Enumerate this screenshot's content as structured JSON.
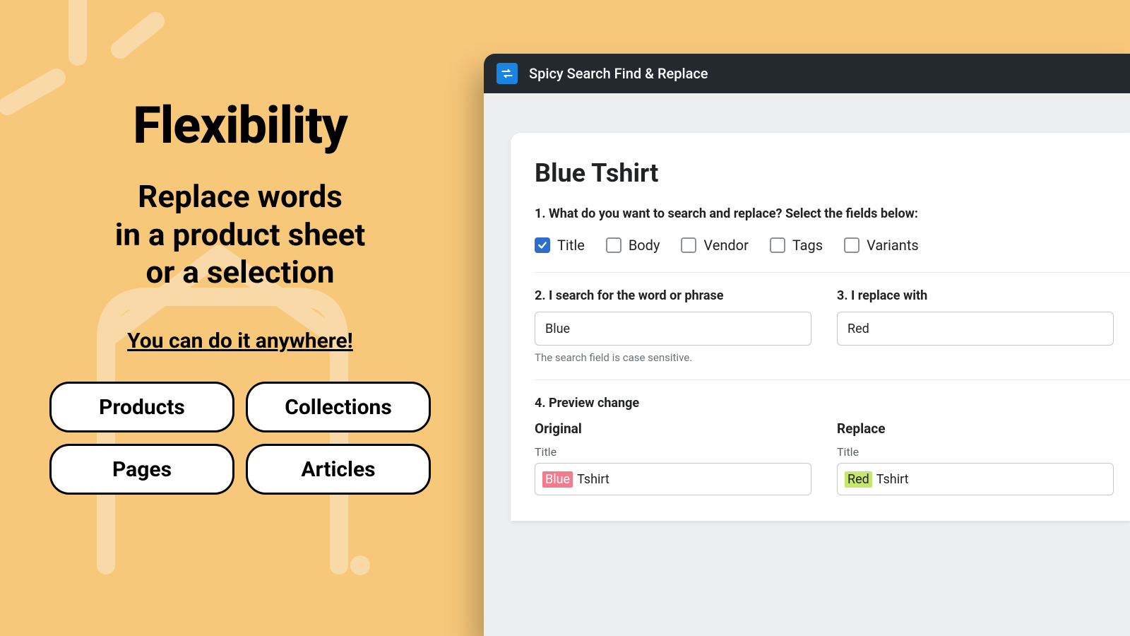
{
  "marketing": {
    "headline": "Flexibility",
    "subhead_line1": "Replace words",
    "subhead_line2": "in a product sheet",
    "subhead_line3": "or a selection",
    "tagline": "You can do it anywhere!",
    "pills": [
      "Products",
      "Collections",
      "Pages",
      "Articles"
    ]
  },
  "app": {
    "title": "Spicy Search Find & Replace",
    "card": {
      "page_title": "Blue Tshirt",
      "step1_label": "1. What do you want to search and replace? Select the fields below:",
      "fields": [
        {
          "label": "Title",
          "checked": true
        },
        {
          "label": "Body",
          "checked": false
        },
        {
          "label": "Vendor",
          "checked": false
        },
        {
          "label": "Tags",
          "checked": false
        },
        {
          "label": "Variants",
          "checked": false
        }
      ],
      "step2_label": "2. I search for the word or phrase",
      "search_value": "Blue",
      "search_hint": "The search field is case sensitive.",
      "step3_label": "3. I replace with",
      "replace_value": "Red",
      "step4_label": "4. Preview change",
      "preview": {
        "original_head": "Original",
        "replace_head": "Replace",
        "field_name": "Title",
        "original": {
          "highlight": "Blue",
          "rest": "Tshirt"
        },
        "replace": {
          "highlight": "Red",
          "rest": "Tshirt"
        }
      }
    }
  }
}
